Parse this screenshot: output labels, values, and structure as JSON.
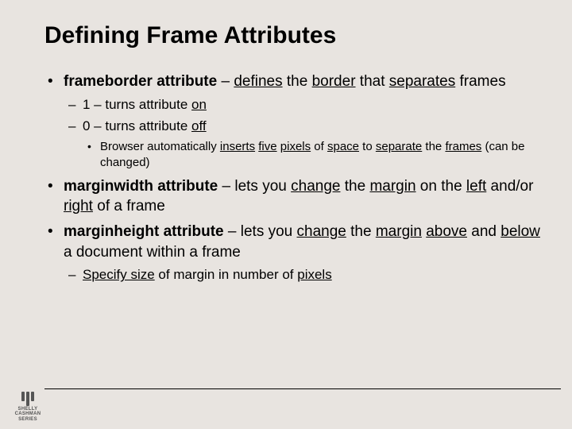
{
  "title": "Defining Frame Attributes",
  "bullets": {
    "b1_bold": "frameborder attribute",
    "b1_t1": " – ",
    "b1_u1": "defines",
    "b1_t2": " the ",
    "b1_u2": "border",
    "b1_t3": " that ",
    "b1_u3": "separates",
    "b1_t4": " frames",
    "b1a_t1": "1 – turns attribute ",
    "b1a_u1": "on",
    "b1b_t1": "0 – turns attribute ",
    "b1b_u1": "off",
    "b1b_i_t1": "Browser automatically ",
    "b1b_i_u1": "inserts",
    "b1b_i_t2": " ",
    "b1b_i_u2": "five",
    "b1b_i_t3": " ",
    "b1b_i_u3": "pixels",
    "b1b_i_t4": " of ",
    "b1b_i_u4": "space",
    "b1b_i_t5": " to ",
    "b1b_i_u5": "separate",
    "b1b_i_t6": " the ",
    "b1b_i_u6": "frames",
    "b1b_i_t7": " (can be changed)",
    "b2_bold": "marginwidth attribute",
    "b2_t1": " – lets you ",
    "b2_u1": "change",
    "b2_t2": " the ",
    "b2_u2": "margin",
    "b2_t3": " on the ",
    "b2_u3": "left",
    "b2_t4": " and/or ",
    "b2_u4": "right",
    "b2_t5": " of a frame",
    "b3_bold": "marginheight attribute",
    "b3_t1": " – lets you ",
    "b3_u1": "change",
    "b3_t2": " the ",
    "b3_u2": "margin",
    "b3_t3": " ",
    "b3_u3": "above",
    "b3_t4": " and ",
    "b3_u4": "below",
    "b3_t5": " a document within a frame",
    "b3a_u1": "Specify size",
    "b3a_t1": " of margin in number of ",
    "b3a_u2": "pixels"
  },
  "logo": {
    "line1": "SHELLY",
    "line2": "CASHMAN",
    "line3": "SERIES"
  }
}
